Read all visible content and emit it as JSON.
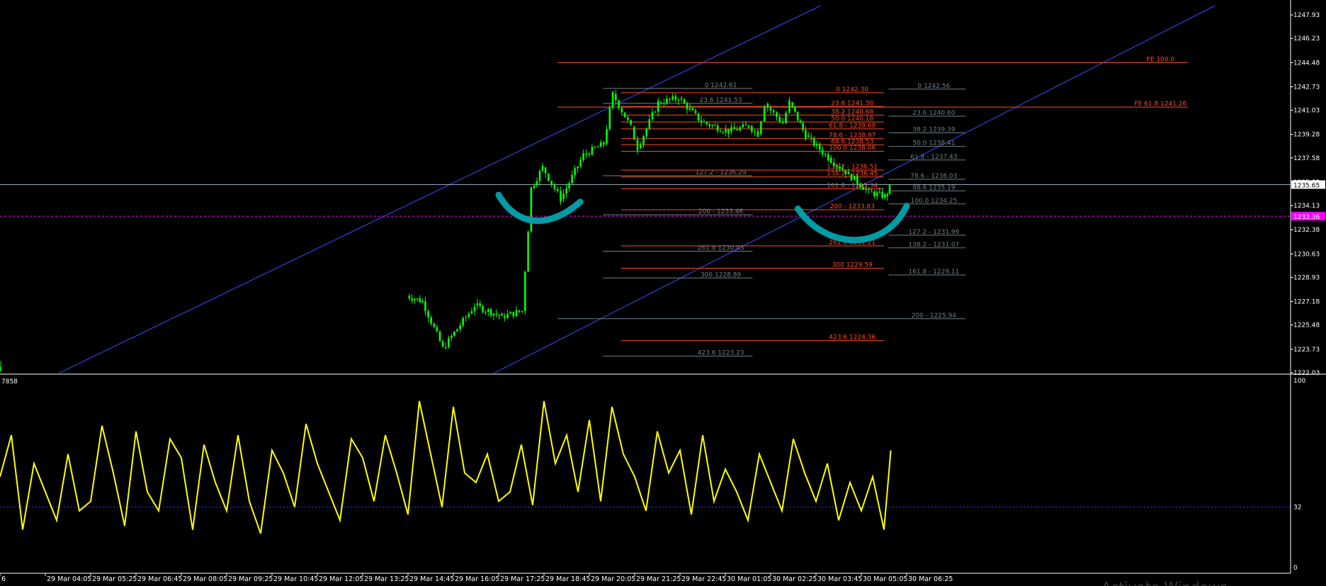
{
  "chart_data": [
    {
      "type": "candlestick",
      "panel": "price",
      "title": "",
      "y_ticks": [
        "1247.93",
        "1246.23",
        "1244.48",
        "1242.73",
        "1241.03",
        "1239.28",
        "1237.58",
        "1235.83",
        "1234.13",
        "1232.38",
        "1230.63",
        "1228.93",
        "1227.18",
        "1225.48",
        "1223.73",
        "1222.03"
      ],
      "ylim": [
        1222.03,
        1248.6
      ],
      "current_price": {
        "label": "1235.65",
        "value": 1235.65
      },
      "alert_level": {
        "label": "1233.36",
        "value": 1233.36
      },
      "segments": [
        {
          "from": 0,
          "to": 0.02,
          "start": 1222.2,
          "end": 1222.3
        },
        {
          "from": 0.02,
          "to": 9.0,
          "start": 1222.0,
          "end": 1222.0,
          "gap": true
        },
        {
          "from": 9.0,
          "to": 9.35,
          "start": 1227.6,
          "end": 1227.2
        },
        {
          "from": 9.35,
          "to": 9.8,
          "start": 1227.2,
          "end": 1223.8
        },
        {
          "from": 9.8,
          "to": 10.5,
          "start": 1223.8,
          "end": 1226.9
        },
        {
          "from": 10.5,
          "to": 11.1,
          "start": 1226.9,
          "end": 1226.1
        },
        {
          "from": 11.1,
          "to": 11.55,
          "start": 1226.1,
          "end": 1226.5
        },
        {
          "from": 11.55,
          "to": 11.75,
          "start": 1226.5,
          "end": 1235.4
        },
        {
          "from": 11.75,
          "to": 12.0,
          "start": 1235.4,
          "end": 1236.9
        },
        {
          "from": 12.0,
          "to": 12.4,
          "start": 1236.9,
          "end": 1234.6
        },
        {
          "from": 12.4,
          "to": 12.9,
          "start": 1234.6,
          "end": 1237.8
        },
        {
          "from": 12.9,
          "to": 13.35,
          "start": 1237.8,
          "end": 1238.6
        },
        {
          "from": 13.35,
          "to": 13.55,
          "start": 1238.6,
          "end": 1242.2
        },
        {
          "from": 13.55,
          "to": 13.95,
          "start": 1242.2,
          "end": 1239.8
        },
        {
          "from": 13.95,
          "to": 14.1,
          "start": 1239.8,
          "end": 1238.3
        },
        {
          "from": 14.1,
          "to": 14.55,
          "start": 1238.3,
          "end": 1241.6
        },
        {
          "from": 14.55,
          "to": 15.0,
          "start": 1241.6,
          "end": 1241.9
        },
        {
          "from": 15.0,
          "to": 15.5,
          "start": 1241.9,
          "end": 1240.2
        },
        {
          "from": 15.5,
          "to": 16.1,
          "start": 1240.2,
          "end": 1239.5
        },
        {
          "from": 16.1,
          "to": 16.55,
          "start": 1239.5,
          "end": 1239.9
        },
        {
          "from": 16.55,
          "to": 16.75,
          "start": 1239.9,
          "end": 1239.3
        },
        {
          "from": 16.75,
          "to": 16.9,
          "start": 1239.3,
          "end": 1241.5
        },
        {
          "from": 16.9,
          "to": 17.3,
          "start": 1241.5,
          "end": 1240.1
        },
        {
          "from": 17.3,
          "to": 17.45,
          "start": 1240.1,
          "end": 1241.6
        },
        {
          "from": 17.45,
          "to": 17.8,
          "start": 1241.6,
          "end": 1239.2
        },
        {
          "from": 17.8,
          "to": 18.3,
          "start": 1239.2,
          "end": 1237.6
        },
        {
          "from": 18.3,
          "to": 18.75,
          "start": 1237.6,
          "end": 1236.4
        },
        {
          "from": 18.75,
          "to": 19.2,
          "start": 1236.4,
          "end": 1235.1
        },
        {
          "from": 19.2,
          "to": 19.55,
          "start": 1235.1,
          "end": 1234.8
        },
        {
          "from": 19.55,
          "to": 19.65,
          "start": 1234.8,
          "end": 1235.4
        }
      ],
      "time_labels": [
        "6",
        "29 Mar 04:05",
        "29 Mar 05:25",
        "29 Mar 06:45",
        "29 Mar 08:05",
        "29 Mar 09:25",
        "29 Mar 10:45",
        "29 Mar 12:05",
        "29 Mar 13:25",
        "29 Mar 14:45",
        "29 Mar 16:05",
        "29 Mar 17:25",
        "29 Mar 18:45",
        "29 Mar 20:05",
        "29 Mar 21:25",
        "29 Mar 22:45",
        "30 Mar 01:05",
        "30 Mar 02:25",
        "30 Mar 03:45",
        "30 Mar 05:05",
        "30 Mar 06:25"
      ],
      "fib_levels": [
        {
          "label": "FE 100.0",
          "value": 1244.48,
          "color": "red",
          "x_from": 12.3,
          "x_to": 26.2,
          "text_at": 25.6
        },
        {
          "label": "0 1242.61",
          "value": 1242.61,
          "color": "gray",
          "x_from": 13.3,
          "x_to": 16.6,
          "text_at": 15.9
        },
        {
          "label": "0 1242.30",
          "value": 1242.3,
          "color": "red",
          "x_from": 13.7,
          "x_to": 19.5,
          "text_at": 18.8
        },
        {
          "label": "0 1242.56",
          "value": 1242.56,
          "color": "gray",
          "x_from": 19.6,
          "x_to": 21.3,
          "text_at": 20.6
        },
        {
          "label": "23.6 1241.53",
          "value": 1241.53,
          "color": "gray",
          "x_from": 13.3,
          "x_to": 16.6,
          "text_at": 15.9
        },
        {
          "label": "23.6 1241.30",
          "value": 1241.3,
          "color": "red",
          "x_from": 13.7,
          "x_to": 19.5,
          "text_at": 18.8
        },
        {
          "label": "FE 61.8 1241.26",
          "value": 1241.26,
          "color": "red",
          "x_from": 12.3,
          "x_to": 26.2,
          "text_at": 25.6
        },
        {
          "label": "38.2 1240.68",
          "value": 1240.68,
          "color": "red",
          "x_from": 13.7,
          "x_to": 19.5,
          "text_at": 18.8
        },
        {
          "label": "23.6 1240.60",
          "value": 1240.6,
          "color": "gray",
          "x_from": 19.6,
          "x_to": 21.3,
          "text_at": 20.6
        },
        {
          "label": "50.0 1240.18",
          "value": 1240.18,
          "color": "red",
          "x_from": 13.7,
          "x_to": 19.5,
          "text_at": 18.8
        },
        {
          "label": "61.8 - 1239.68",
          "value": 1239.68,
          "color": "red",
          "x_from": 13.7,
          "x_to": 19.5,
          "text_at": 18.8
        },
        {
          "label": "38.2 1239.39",
          "value": 1239.39,
          "color": "gray",
          "x_from": 19.6,
          "x_to": 21.3,
          "text_at": 20.6
        },
        {
          "label": "78.6 - 1238.97",
          "value": 1238.97,
          "color": "red",
          "x_from": 13.7,
          "x_to": 19.5,
          "text_at": 18.8
        },
        {
          "label": "88.6 1238.53",
          "value": 1238.53,
          "color": "red",
          "x_from": 13.7,
          "x_to": 19.5,
          "text_at": 18.8
        },
        {
          "label": "50.0 1238.41",
          "value": 1238.41,
          "color": "gray",
          "x_from": 19.6,
          "x_to": 21.3,
          "text_at": 20.6
        },
        {
          "label": "100.0 1238.06",
          "value": 1238.06,
          "color": "red",
          "x_from": 13.7,
          "x_to": 19.5,
          "text_at": 18.8
        },
        {
          "label": "61.8 - 1237.43",
          "value": 1237.43,
          "color": "gray",
          "x_from": 19.6,
          "x_to": 21.3,
          "text_at": 20.6
        },
        {
          "label": "127.2 - 1236.29",
          "value": 1236.29,
          "color": "gray",
          "x_from": 13.3,
          "x_to": 16.6,
          "text_at": 15.9
        },
        {
          "label": "138.2 - 1236.51",
          "value": 1236.7,
          "color": "red",
          "x_from": 13.7,
          "x_to": 19.5,
          "text_at": 18.8
        },
        {
          "label": "138.2 - 1236.45",
          "value": 1236.2,
          "color": "red",
          "x_from": 13.7,
          "x_to": 19.5,
          "text_at": 18.8
        },
        {
          "label": "78.6 - 1236.03",
          "value": 1236.03,
          "color": "gray",
          "x_from": 19.6,
          "x_to": 21.3,
          "text_at": 20.6
        },
        {
          "label": "161.8 - 1235.34",
          "value": 1235.34,
          "color": "red",
          "x_from": 13.7,
          "x_to": 19.5,
          "text_at": 18.8
        },
        {
          "label": "88.6 1235.19",
          "value": 1235.19,
          "color": "gray",
          "x_from": 19.6,
          "x_to": 21.3,
          "text_at": 20.6
        },
        {
          "label": "100.0 1234.25",
          "value": 1234.25,
          "color": "gray",
          "x_from": 19.6,
          "x_to": 21.3,
          "text_at": 20.6
        },
        {
          "label": "200 - 1233.83",
          "value": 1233.83,
          "color": "red",
          "x_from": 13.7,
          "x_to": 19.5,
          "text_at": 18.8
        },
        {
          "label": "200 - 1233.46",
          "value": 1233.46,
          "color": "gray",
          "x_from": 13.3,
          "x_to": 16.6,
          "text_at": 15.9
        },
        {
          "label": "127.2 - 1231.99",
          "value": 1231.99,
          "color": "gray",
          "x_from": 19.6,
          "x_to": 21.3,
          "text_at": 20.6
        },
        {
          "label": "261.8 1231.21",
          "value": 1231.21,
          "color": "red",
          "x_from": 13.7,
          "x_to": 19.5,
          "text_at": 18.8
        },
        {
          "label": "138.2 - 1231.07",
          "value": 1231.07,
          "color": "gray",
          "x_from": 19.6,
          "x_to": 21.3,
          "text_at": 20.6
        },
        {
          "label": "261.8 1230.83",
          "value": 1230.83,
          "color": "gray",
          "x_from": 13.3,
          "x_to": 16.6,
          "text_at": 15.9
        },
        {
          "label": "300 1229.59",
          "value": 1229.59,
          "color": "red",
          "x_from": 13.7,
          "x_to": 19.5,
          "text_at": 18.8
        },
        {
          "label": "161.8 - 1229.11",
          "value": 1229.11,
          "color": "gray",
          "x_from": 19.6,
          "x_to": 21.3,
          "text_at": 20.6
        },
        {
          "label": "300 1228.89",
          "value": 1228.89,
          "color": "gray",
          "x_from": 13.3,
          "x_to": 16.6,
          "text_at": 15.9
        },
        {
          "label": "200 - 1225.94",
          "value": 1225.94,
          "color": "gray",
          "x_from": 12.3,
          "x_to": 21.3,
          "text_at": 20.6
        },
        {
          "label": "423.6 1224.36",
          "value": 1224.36,
          "color": "red",
          "x_from": 13.7,
          "x_to": 19.5,
          "text_at": 18.8
        },
        {
          "label": "423.6 1223.23",
          "value": 1223.23,
          "color": "gray",
          "x_from": 13.3,
          "x_to": 16.6,
          "text_at": 15.9
        }
      ],
      "channel_lines": [
        {
          "x1": 1.3,
          "y1": 1222.0,
          "x2": 18.1,
          "y2": 1248.6
        },
        {
          "x1": 10.9,
          "y1": 1222.0,
          "x2": 26.8,
          "y2": 1248.6
        }
      ],
      "annotation_arcs": [
        {
          "points": [
            [
              11.0,
              1234.9
            ],
            [
              11.4,
              1232.6
            ],
            [
              12.1,
              1232.4
            ],
            [
              12.8,
              1234.4
            ]
          ]
        },
        {
          "points": [
            [
              17.6,
              1233.9
            ],
            [
              18.2,
              1231.0
            ],
            [
              19.5,
              1230.7
            ],
            [
              20.0,
              1234.1
            ]
          ]
        }
      ]
    },
    {
      "type": "line",
      "panel": "indicator",
      "title": "",
      "header_label": "7858",
      "y_ticks": [
        "100",
        "32",
        "0"
      ],
      "ylim": [
        0,
        100
      ],
      "level_line": 32,
      "line_color": "#ffff00",
      "x": [
        0,
        0.25,
        0.5,
        0.75,
        1,
        1.25,
        1.5,
        1.75,
        2,
        2.25,
        2.5,
        2.75,
        3,
        3.25,
        3.5,
        3.75,
        4,
        4.25,
        4.5,
        4.75,
        5,
        5.25,
        5.5,
        5.75,
        6,
        6.25,
        6.5,
        6.75,
        7,
        7.25,
        7.5,
        7.75,
        8,
        8.25,
        8.5,
        8.75,
        9,
        9.25,
        9.5,
        9.75,
        10,
        10.25,
        10.5,
        10.75,
        11,
        11.25,
        11.5,
        11.75,
        12,
        12.25,
        12.5,
        12.75,
        13,
        13.25,
        13.5,
        13.75,
        14,
        14.25,
        14.5,
        14.75,
        15,
        15.25,
        15.5,
        15.75,
        16,
        16.25,
        16.5,
        16.75,
        17,
        17.25,
        17.5,
        17.75,
        18,
        18.25,
        18.5,
        18.75,
        19,
        19.25,
        19.5,
        19.65
      ],
      "values": [
        48,
        70,
        20,
        55,
        40,
        25,
        60,
        30,
        35,
        75,
        50,
        22,
        72,
        40,
        30,
        68,
        58,
        20,
        65,
        45,
        30,
        70,
        35,
        18,
        62,
        50,
        32,
        76,
        55,
        40,
        25,
        68,
        58,
        35,
        70,
        50,
        28,
        88,
        60,
        32,
        85,
        50,
        45,
        60,
        35,
        40,
        65,
        33,
        88,
        55,
        70,
        40,
        78,
        35,
        85,
        60,
        48,
        30,
        72,
        50,
        62,
        28,
        70,
        35,
        52,
        40,
        25,
        60,
        45,
        30,
        68,
        50,
        35,
        55,
        25,
        45,
        30,
        48,
        20,
        62
      ]
    }
  ],
  "watermark": {
    "text": "Activate Windows"
  },
  "colors": {
    "background": "#000000",
    "candle": "#00ff00",
    "fib_red": "#ff4a2a",
    "fib_gray": "#6f7f86",
    "channel": "#3a4cff",
    "annotation": "#009ca6",
    "alert": "#ff00ff",
    "indicator": "#ffff00"
  }
}
